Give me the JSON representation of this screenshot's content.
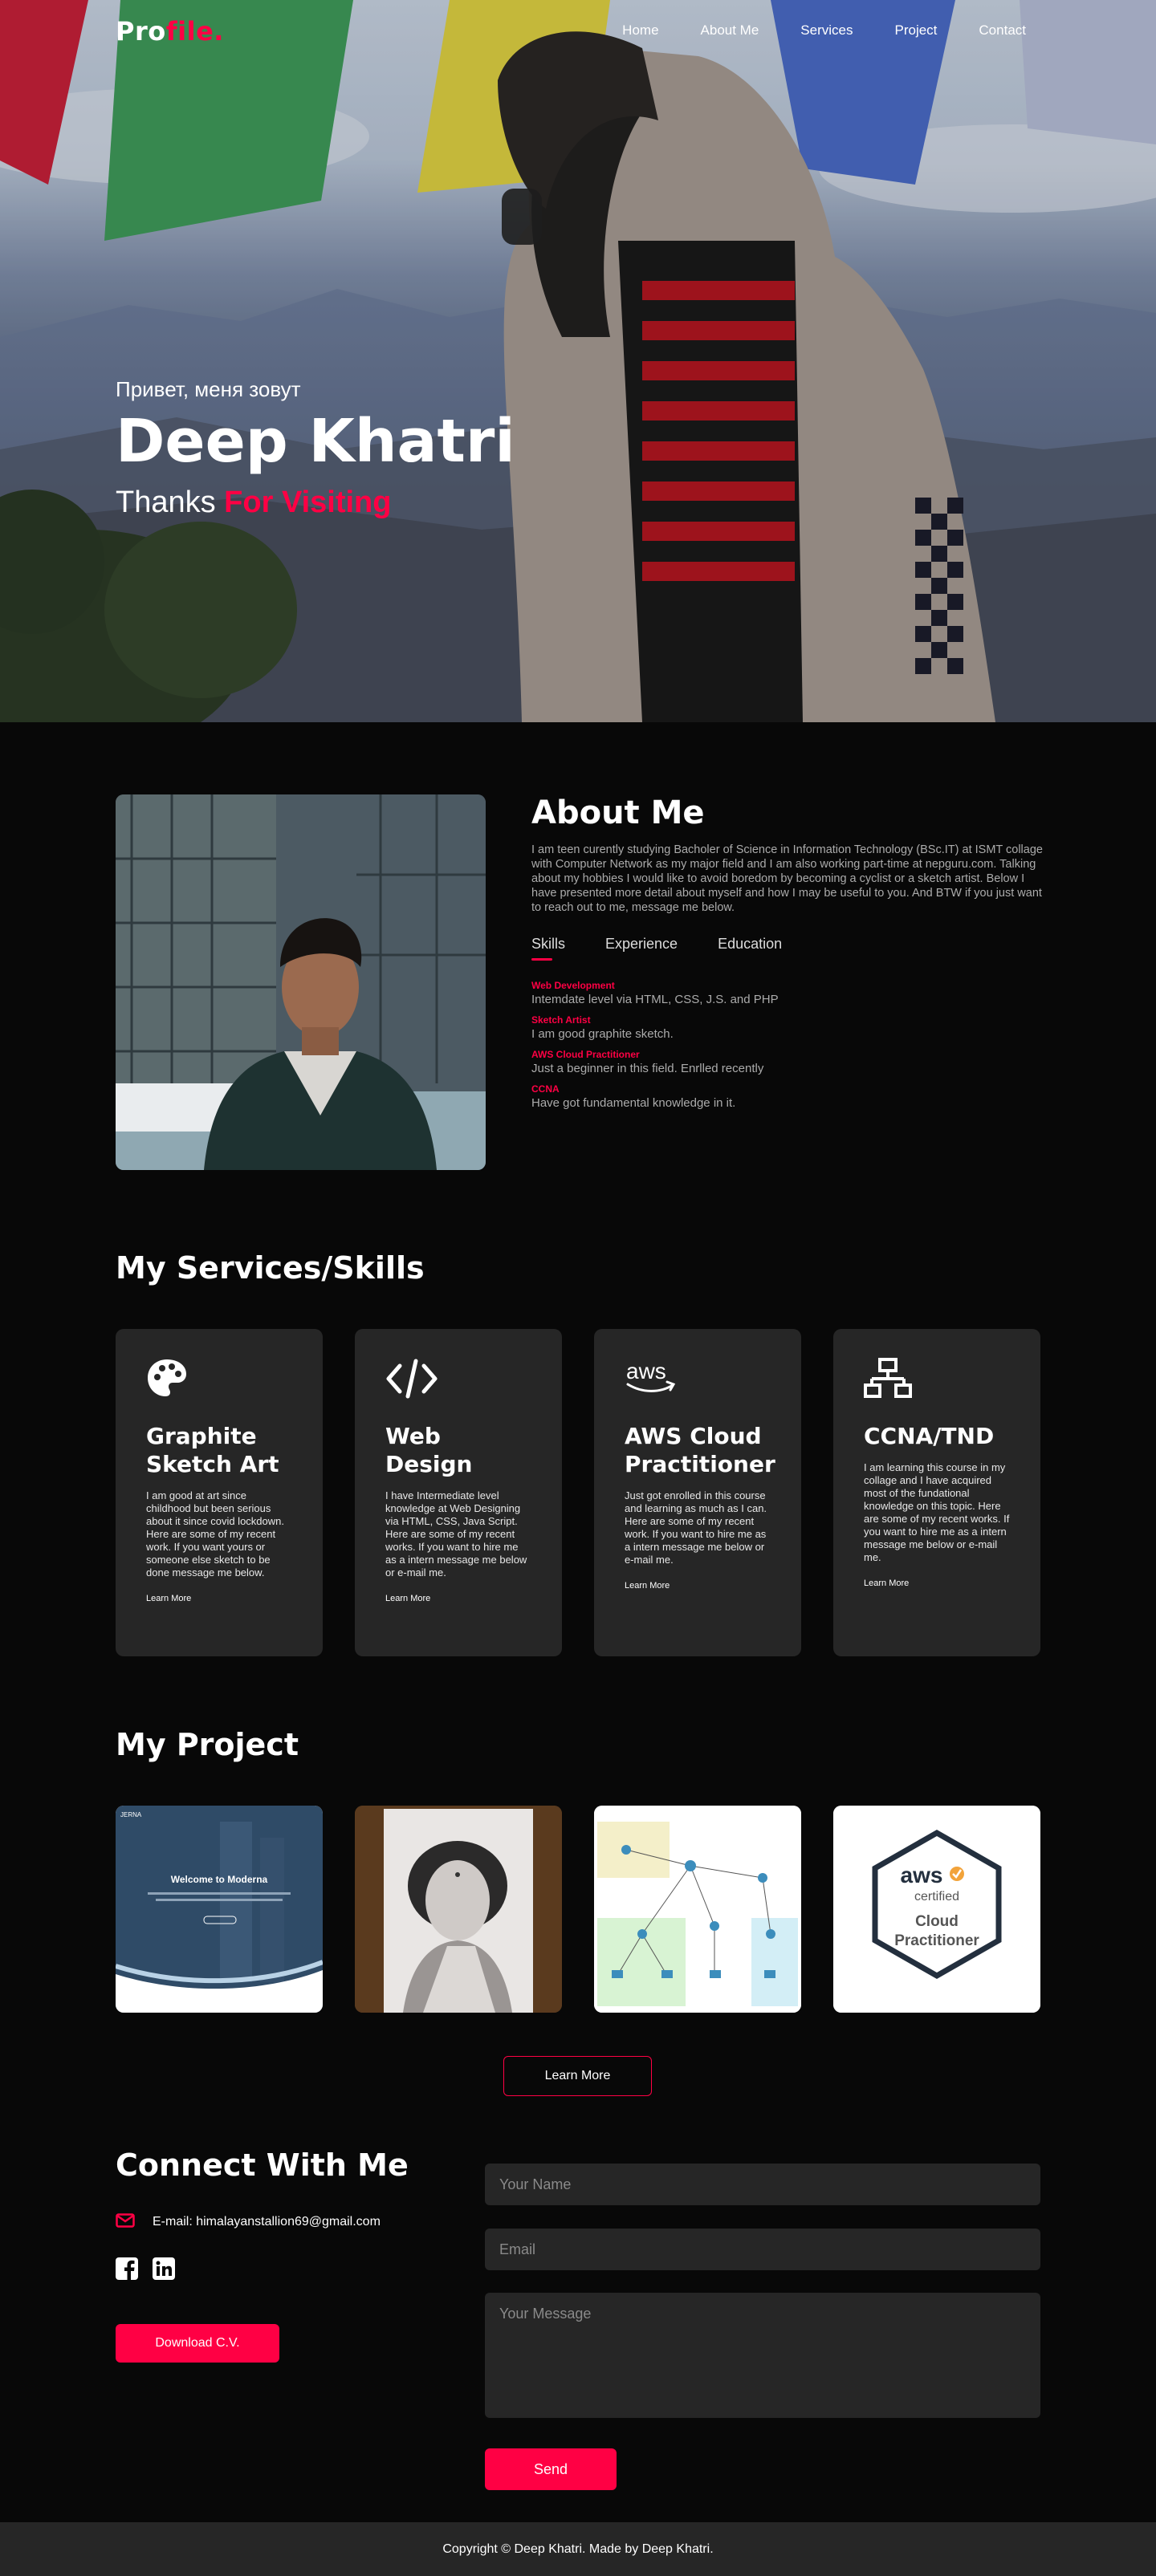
{
  "brand": {
    "logo_part1": "Pro",
    "logo_part2": "file."
  },
  "nav": {
    "items": [
      "Home",
      "About Me",
      "Services",
      "Project",
      "Contact"
    ]
  },
  "hero": {
    "greeting": "Привет, меня зовут",
    "name": "Deep Khatri",
    "sub_plain": "Thanks ",
    "sub_highlight": "For Visiting"
  },
  "about": {
    "title": "About Me",
    "paragraph": "I am teen curently studying Bacholer of Science in Information Technology (BSc.IT) at ISMT collage with Computer Network as my major field and I am also working part-time at nepguru.com. Talking about my hobbies I would like to avoid boredom by becoming a cyclist or a sketch artist. Below I have presented more detail about myself and how I may be useful to you. And BTW if you just want to reach out to me, message me below.",
    "tabs": [
      "Skills",
      "Experience",
      "Education"
    ],
    "skills": [
      {
        "title": "Web Development",
        "desc": "Intemdate level via HTML, CSS, J.S. and PHP"
      },
      {
        "title": "Sketch Artist",
        "desc": "I am good graphite sketch."
      },
      {
        "title": "AWS Cloud Practitioner",
        "desc": "Just a beginner in this field. Enrlled recently"
      },
      {
        "title": "CCNA",
        "desc": "Have got fundamental knowledge in it."
      }
    ]
  },
  "services": {
    "title": "My Services/Skills",
    "cards": [
      {
        "icon": "palette-icon",
        "title": "Graphite Sketch Art",
        "desc": "I am good at art since childhood but been serious about it since covid lockdown. Here are some of my recent work. If you want yours or someone else sketch to be done message me below.",
        "link": "Learn More"
      },
      {
        "icon": "code-icon",
        "title": "Web Design",
        "desc": "I have Intermediate level knowledge at Web Designing via HTML, CSS, Java Script. Here are some of my recent works. If you want to hire me as a intern message me below or e-mail me.",
        "link": "Learn More"
      },
      {
        "icon": "aws-icon",
        "title": "AWS Cloud Practitioner",
        "desc": "Just got enrolled in this course and learning as much as I can. Here are some of my recent work. If you want to hire me as a intern message me below or e-mail me.",
        "link": "Learn More"
      },
      {
        "icon": "network-icon",
        "title": "CCNA/TND",
        "desc": "I am learning this course in my collage and I have acquired most of the fundational knowledge on this topic. Here are some of my recent works. If you want to hire me as a intern message me below or e-mail me.",
        "link": "Learn More"
      }
    ]
  },
  "projects": {
    "title": "My Project",
    "thumb1": {
      "logo": "JERNA",
      "welcome": "Welcome to Moderna"
    },
    "thumb4": {
      "brand": "aws",
      "certified": "certified",
      "line1": "Cloud",
      "line2": "Practitioner"
    },
    "button": "Learn More"
  },
  "connect": {
    "title": "Connect With Me",
    "email_text": "E-mail: himalayanstallion69@gmail.com",
    "download_label": "Download C.V.",
    "name_placeholder": "Your Name",
    "email_placeholder": "Email",
    "message_placeholder": "Your Message",
    "send_label": "Send"
  },
  "footer": {
    "text": "Copyright © Deep Khatri. Made by Deep Khatri."
  },
  "colors": {
    "accent": "#ff0044",
    "background": "#080808",
    "card": "#262626"
  }
}
